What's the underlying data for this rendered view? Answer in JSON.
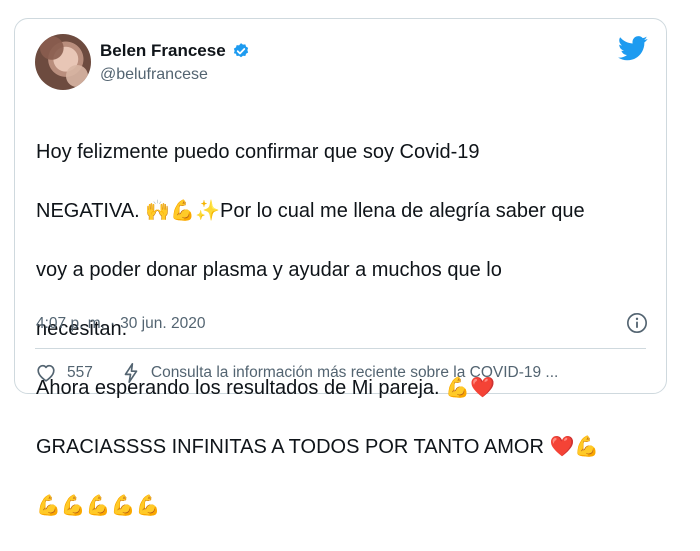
{
  "author": {
    "name": "Belen Francese",
    "handle": "@belufrancese",
    "verified": true
  },
  "tweet": {
    "lines": [
      "Hoy felizmente puedo confirmar que soy Covid-19",
      "NEGATIVA. 🙌💪✨Por lo cual me llena de alegría saber que",
      "voy a poder donar plasma y ayudar a muchos que lo",
      "necesitan.",
      "Ahora esperando los resultados de Mi pareja. 💪❤️",
      "GRACIASSSS INFINITAS A TODOS POR TANTO AMOR ❤️💪",
      "💪💪💪💪💪"
    ]
  },
  "meta": {
    "time": "4:07 p. m.",
    "separator": "·",
    "date": "30 jun. 2020"
  },
  "actions": {
    "like_count": "557",
    "covid_info": "Consulta la información más reciente sobre la COVID-19 ..."
  },
  "colors": {
    "twitter_blue": "#1d9bf0",
    "text_primary": "#0f1419",
    "text_secondary": "#536471",
    "border": "#cfd9de"
  },
  "icons": {
    "logo": "twitter-bird-icon",
    "verified": "verified-badge-icon",
    "info": "info-icon",
    "like": "heart-icon",
    "covid": "lightning-icon"
  }
}
